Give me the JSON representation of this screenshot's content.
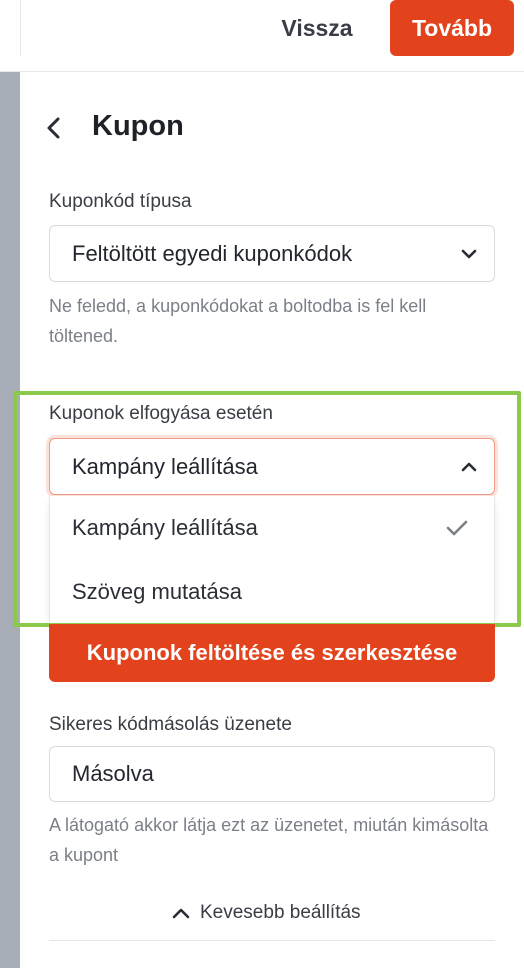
{
  "topbar": {
    "back_label": "Vissza",
    "next_label": "Tovább"
  },
  "panel": {
    "title": "Kupon"
  },
  "coupon_type": {
    "label": "Kuponkód típusa",
    "value": "Feltöltött egyedi kuponkódok",
    "help": "Ne feledd, a kuponkódokat a boltodba is fel kell töltened."
  },
  "out_of_coupons": {
    "label": "Kuponok elfogyása esetén",
    "value": "Kampány leállítása",
    "options": [
      {
        "label": "Kampány leállítása",
        "selected": true
      },
      {
        "label": "Szöveg mutatása",
        "selected": false
      }
    ]
  },
  "upload_button": {
    "label": "Kuponok feltöltése és szerkesztése"
  },
  "copy_message": {
    "label": "Sikeres kódmásolás üzenete",
    "value": "Másolva",
    "help": "A látogató akkor látja ezt az üzenetet, miután kimásolta a kupont"
  },
  "less_settings": {
    "label": "Kevesebb beállítás"
  },
  "colors": {
    "accent": "#e3431c",
    "highlight": "#8cc94b",
    "rail": "#a8aeb7"
  },
  "icons": [
    "chevron-left-icon",
    "chevron-down-icon",
    "chevron-up-icon",
    "check-icon"
  ]
}
